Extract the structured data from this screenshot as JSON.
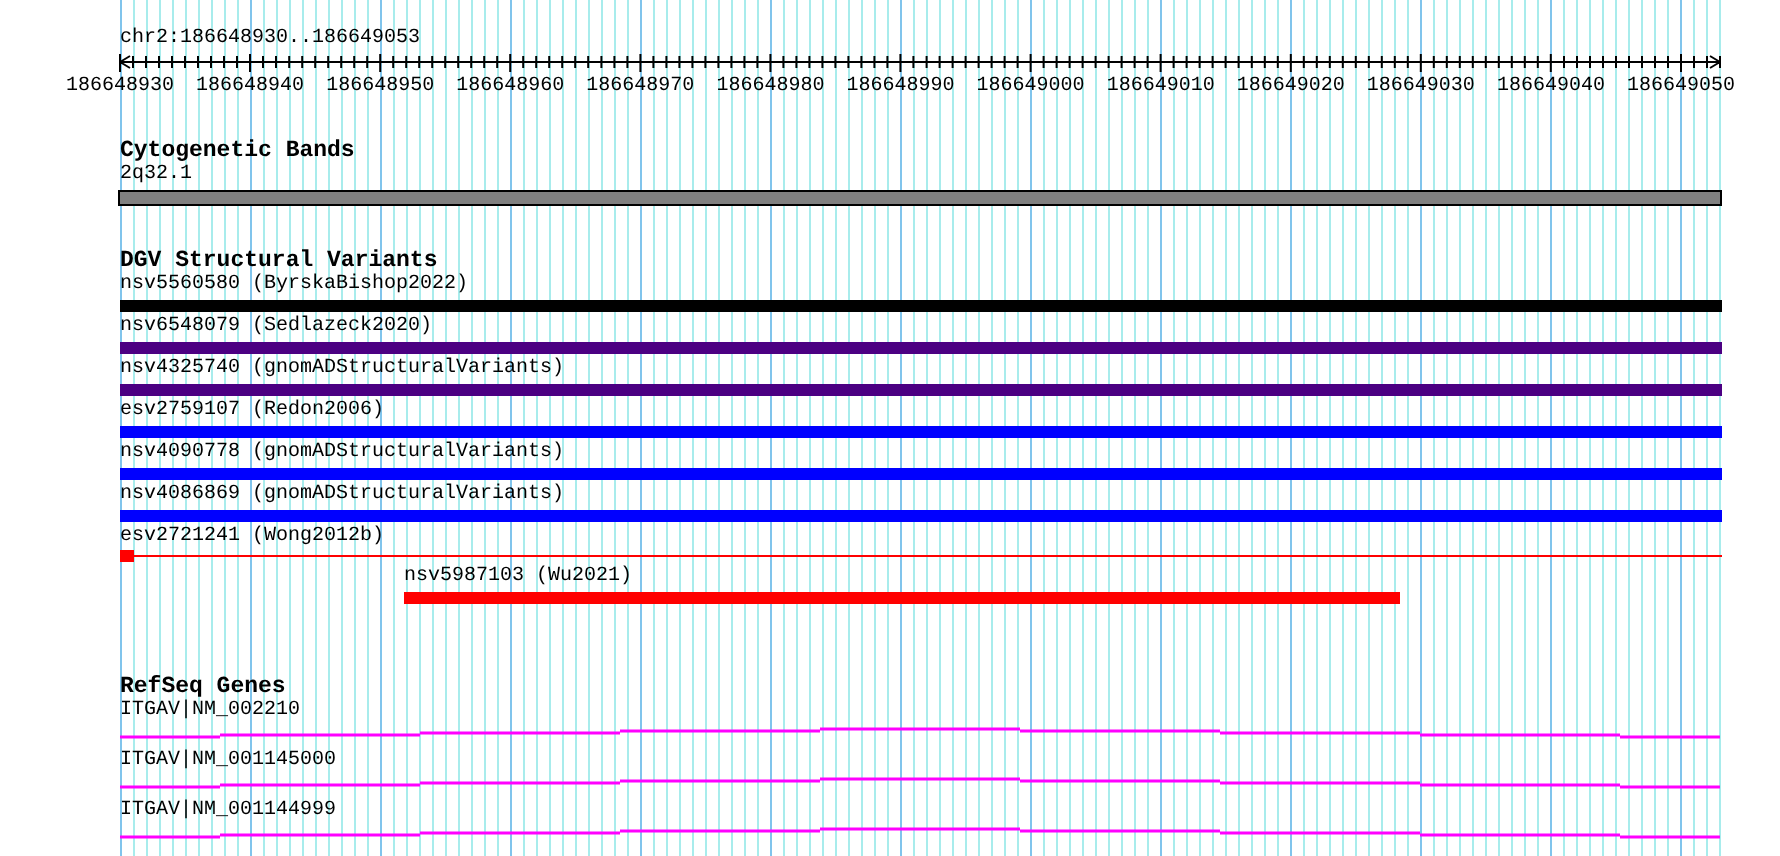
{
  "ruler": {
    "location": "chr2:186648930..186649053",
    "ticks": [
      "186648930",
      "186648940",
      "186648950",
      "186648960",
      "186648970",
      "186648980",
      "186648990",
      "186649000",
      "186649010",
      "186649020",
      "186649030",
      "186649040",
      "186649050"
    ]
  },
  "tracks": [
    {
      "title": "Cytogenetic Bands",
      "features": [
        {
          "label": "2q32.1",
          "kind": "band"
        }
      ]
    },
    {
      "title": "DGV Structural Variants",
      "features": [
        {
          "label": "nsv5560580 (ByrskaBishop2022)",
          "kind": "full",
          "color": "#000000"
        },
        {
          "label": "nsv6548079 (Sedlazeck2020)",
          "kind": "full",
          "color": "#4b0082"
        },
        {
          "label": "nsv4325740 (gnomADStructuralVariants)",
          "kind": "full",
          "color": "#4b0082"
        },
        {
          "label": "esv2759107 (Redon2006)",
          "kind": "full",
          "color": "#0000ff"
        },
        {
          "label": "nsv4090778 (gnomADStructuralVariants)",
          "kind": "full",
          "color": "#0000ff"
        },
        {
          "label": "nsv4086869 (gnomADStructuralVariants)",
          "kind": "full",
          "color": "#0000ff"
        },
        {
          "label": "esv2721241 (Wong2012b)",
          "kind": "stub",
          "color": "#ff0000"
        },
        {
          "label": "nsv5987103 (Wu2021)",
          "kind": "partial",
          "color": "#ff0000"
        }
      ]
    },
    {
      "title": "RefSeq Genes",
      "features": [
        {
          "label": "ITGAV|NM_002210",
          "kind": "transcript"
        },
        {
          "label": "ITGAV|NM_001145000",
          "kind": "transcript"
        },
        {
          "label": "ITGAV|NM_001144999",
          "kind": "transcript"
        }
      ]
    }
  ]
}
